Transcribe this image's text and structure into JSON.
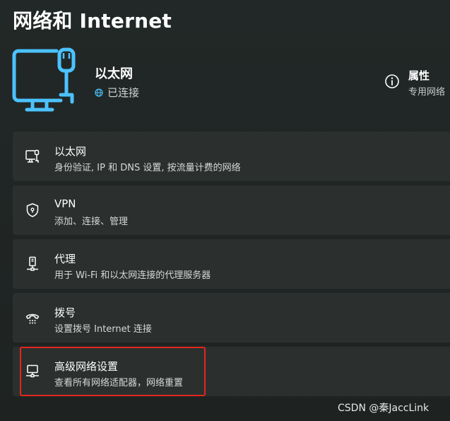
{
  "page": {
    "title": "网络和 Internet"
  },
  "connection": {
    "name": "以太网",
    "status": "已连接",
    "icon": "ethernet-monitor-icon",
    "accent_color": "#4cc2ff"
  },
  "properties": {
    "label": "属性",
    "subtitle": "专用网络",
    "icon": "info-icon"
  },
  "settings": [
    {
      "title": "以太网",
      "subtitle": "身份验证, IP 和 DNS 设置, 按流量计费的网络",
      "icon": "ethernet-icon"
    },
    {
      "title": "VPN",
      "subtitle": "添加、连接、管理",
      "icon": "shield-icon"
    },
    {
      "title": "代理",
      "subtitle": "用于 Wi-Fi 和以太网连接的代理服务器",
      "icon": "proxy-icon"
    },
    {
      "title": "拨号",
      "subtitle": "设置拨号 Internet 连接",
      "icon": "dialup-icon"
    },
    {
      "title": "高级网络设置",
      "subtitle": "查看所有网络适配器，网络重置",
      "icon": "network-adapter-icon"
    }
  ],
  "annotation": {
    "highlight_color": "#e3261d"
  },
  "watermark": "CSDN @秦JaccLink"
}
